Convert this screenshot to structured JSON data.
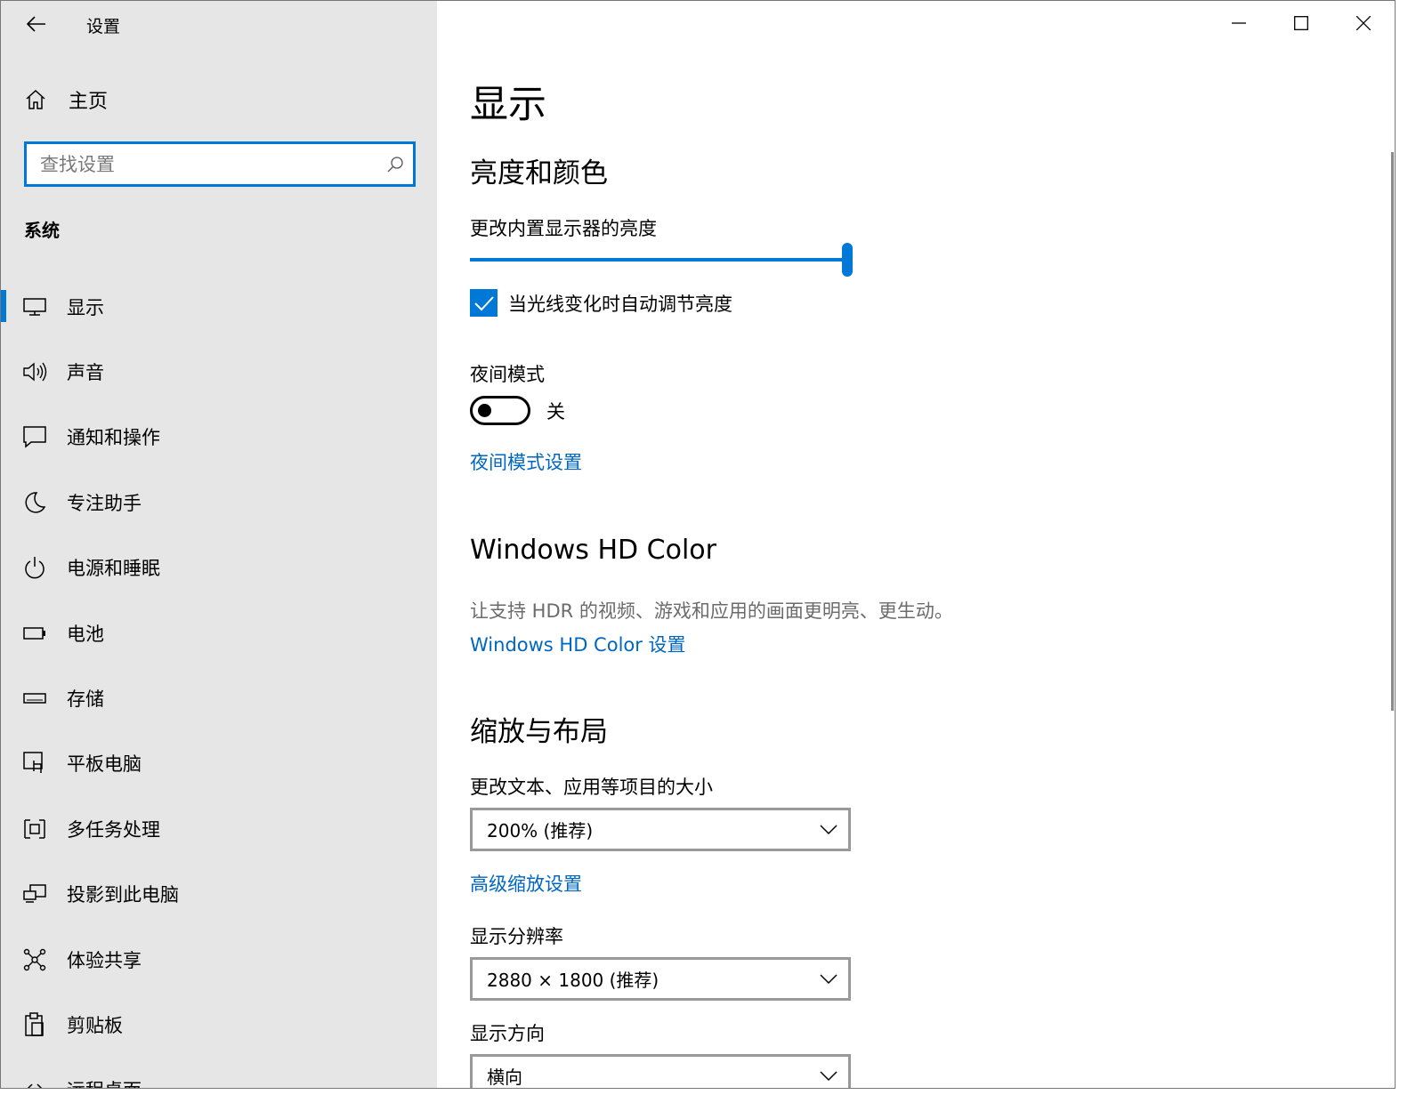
{
  "window": {
    "title": "设置"
  },
  "sidebar": {
    "home_label": "主页",
    "search_placeholder": "查找设置",
    "section_label": "系统",
    "items": [
      {
        "label": "显示",
        "icon": "monitor-icon",
        "active": true
      },
      {
        "label": "声音",
        "icon": "speaker-icon"
      },
      {
        "label": "通知和操作",
        "icon": "message-icon"
      },
      {
        "label": "专注助手",
        "icon": "moon-icon"
      },
      {
        "label": "电源和睡眠",
        "icon": "power-icon"
      },
      {
        "label": "电池",
        "icon": "battery-icon"
      },
      {
        "label": "存储",
        "icon": "storage-icon"
      },
      {
        "label": "平板电脑",
        "icon": "tablet-icon"
      },
      {
        "label": "多任务处理",
        "icon": "multitask-icon"
      },
      {
        "label": "投影到此电脑",
        "icon": "project-icon"
      },
      {
        "label": "体验共享",
        "icon": "share-icon"
      },
      {
        "label": "剪贴板",
        "icon": "clipboard-icon"
      },
      {
        "label": "远程桌面",
        "icon": "remote-icon"
      }
    ]
  },
  "main": {
    "page_title": "显示",
    "brightness": {
      "heading": "亮度和颜色",
      "slider_label": "更改内置显示器的亮度",
      "slider_value": 1.0,
      "auto_label": "当光线变化时自动调节亮度",
      "auto_checked": true
    },
    "night": {
      "label": "夜间模式",
      "state": "关",
      "settings_link": "夜间模式设置"
    },
    "hdr": {
      "heading": "Windows HD Color",
      "description": "让支持 HDR 的视频、游戏和应用的画面更明亮、更生动。",
      "link": "Windows HD Color 设置"
    },
    "scale": {
      "heading": "缩放与布局",
      "size_label": "更改文本、应用等项目的大小",
      "size_value": "200% (推荐)",
      "advanced_link": "高级缩放设置",
      "resolution_label": "显示分辨率",
      "resolution_value": "2880 × 1800 (推荐)",
      "orientation_label": "显示方向",
      "orientation_value": "横向"
    }
  },
  "colors": {
    "accent": "#0078d7",
    "link": "#0067c0",
    "sidebar_bg": "#e6e6e6"
  }
}
